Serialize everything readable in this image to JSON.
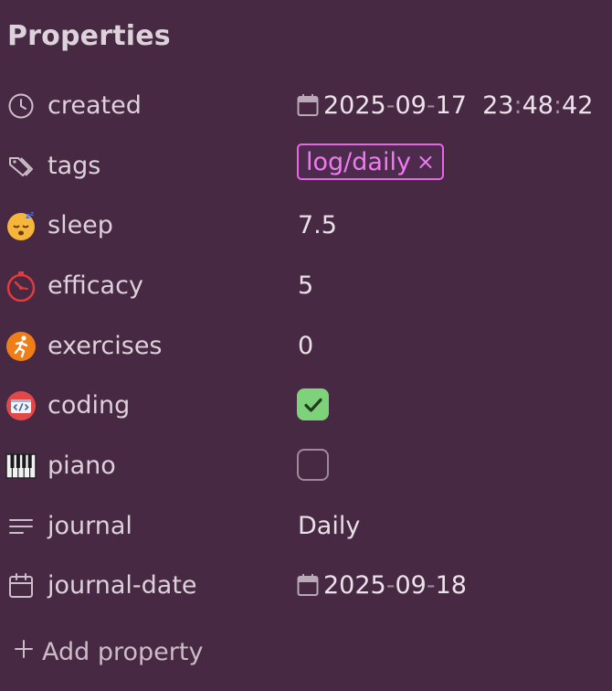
{
  "panel": {
    "title": "Properties",
    "add_label": "Add property"
  },
  "properties": [
    {
      "key": "created",
      "icon": "clock-icon",
      "type": "datetime",
      "date": [
        "2025",
        "09",
        "17"
      ],
      "time": [
        "23",
        "48",
        "42"
      ]
    },
    {
      "key": "tags",
      "icon": "tags-icon",
      "type": "tags",
      "tags": [
        "log/daily"
      ],
      "remove_glyph": "×"
    },
    {
      "key": "sleep",
      "icon": "sleeping-face-icon",
      "type": "number",
      "value": "7.5"
    },
    {
      "key": "efficacy",
      "icon": "stopwatch-icon",
      "type": "number",
      "value": "5"
    },
    {
      "key": "exercises",
      "icon": "running-person-icon",
      "type": "number",
      "value": "0"
    },
    {
      "key": "coding",
      "icon": "code-tag-icon",
      "type": "checkbox",
      "checked": true
    },
    {
      "key": "piano",
      "icon": "piano-keys-icon",
      "type": "checkbox",
      "checked": false
    },
    {
      "key": "journal",
      "icon": "text-lines-icon",
      "type": "text",
      "value": "Daily"
    },
    {
      "key": "journal-date",
      "icon": "calendar-icon",
      "type": "date",
      "date": [
        "2025",
        "09",
        "18"
      ]
    }
  ],
  "colors": {
    "background": "#472944",
    "tag_accent": "#e667e5",
    "checkbox_checked": "#7ed27a"
  }
}
